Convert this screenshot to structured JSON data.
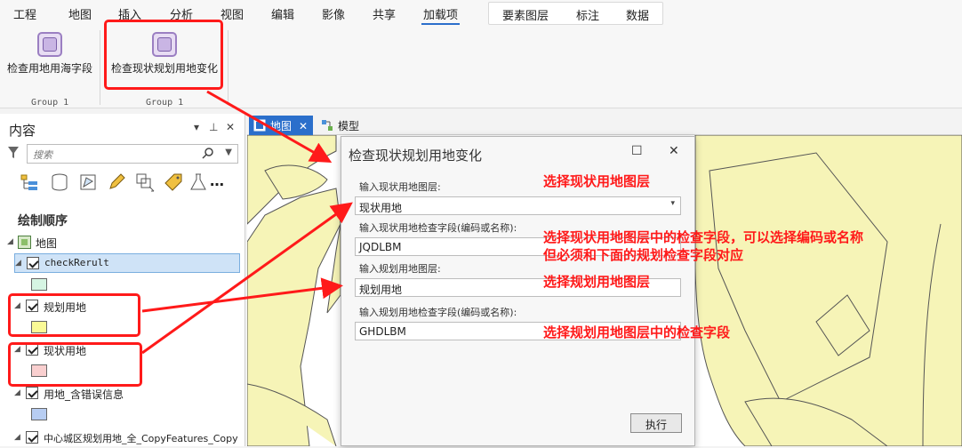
{
  "ribbon": {
    "tabs": [
      "工程",
      "地图",
      "插入",
      "分析",
      "视图",
      "编辑",
      "影像",
      "共享",
      "加载项"
    ],
    "active_tab": "加载项",
    "context_tabs": [
      "要素图层",
      "标注",
      "数据"
    ],
    "buttons": [
      {
        "label": "检查用地用海字段",
        "icon": "addin-square-icon"
      },
      {
        "label": "检查现状规划用地变化",
        "icon": "addin-square-icon"
      }
    ],
    "group_labels": [
      "Group 1",
      "Group 1"
    ]
  },
  "contents": {
    "title": "内容",
    "controls": [
      "▾",
      "⊥",
      "✕"
    ],
    "search_placeholder": "搜索",
    "draw_order_label": "绘制顺序",
    "map_name": "地图",
    "layers": [
      {
        "name": "checkRerult",
        "swatch_color": "#d6f5e3",
        "selected": true
      },
      {
        "name": "规划用地",
        "swatch_color": "#fafa96"
      },
      {
        "name": "现状用地",
        "swatch_color": "#f9cfcf"
      },
      {
        "name": "用地_含错误信息",
        "swatch_color": "#b7cdf2"
      },
      {
        "name": "中心城区规划用地_全_CopyFeatures_Copy"
      }
    ]
  },
  "map_view": {
    "tabs": [
      {
        "label": "地图",
        "close": "✕",
        "icon": "map-icon"
      },
      {
        "label": "模型",
        "icon": "model-icon"
      }
    ],
    "fill_color": "#f6f4b7"
  },
  "dialog": {
    "title": "检查现状规划用地变化",
    "maximize": "☐",
    "close": "✕",
    "fields": [
      {
        "label": "输入现状用地图层:",
        "value": "现状用地",
        "dropdown": true
      },
      {
        "label": "输入现状用地检查字段(编码或名称):",
        "value": "JQDLBM"
      },
      {
        "label": "输入规划用地图层:",
        "value": "规划用地"
      },
      {
        "label": "输入规划用地检查字段(编码或名称):",
        "value": "GHDLBM"
      }
    ],
    "run_label": "执行"
  },
  "annotations": {
    "a1": "选择现状用地图层",
    "a2_line1": "选择现状用地图层中的检查字段，可以选择编码或名称",
    "a2_line2": "但必须和下面的规划检查字段对应",
    "a3": "选择规划用地图层",
    "a4": "选择规划用地图层中的检查字段",
    "color": "#ff1a1a"
  }
}
